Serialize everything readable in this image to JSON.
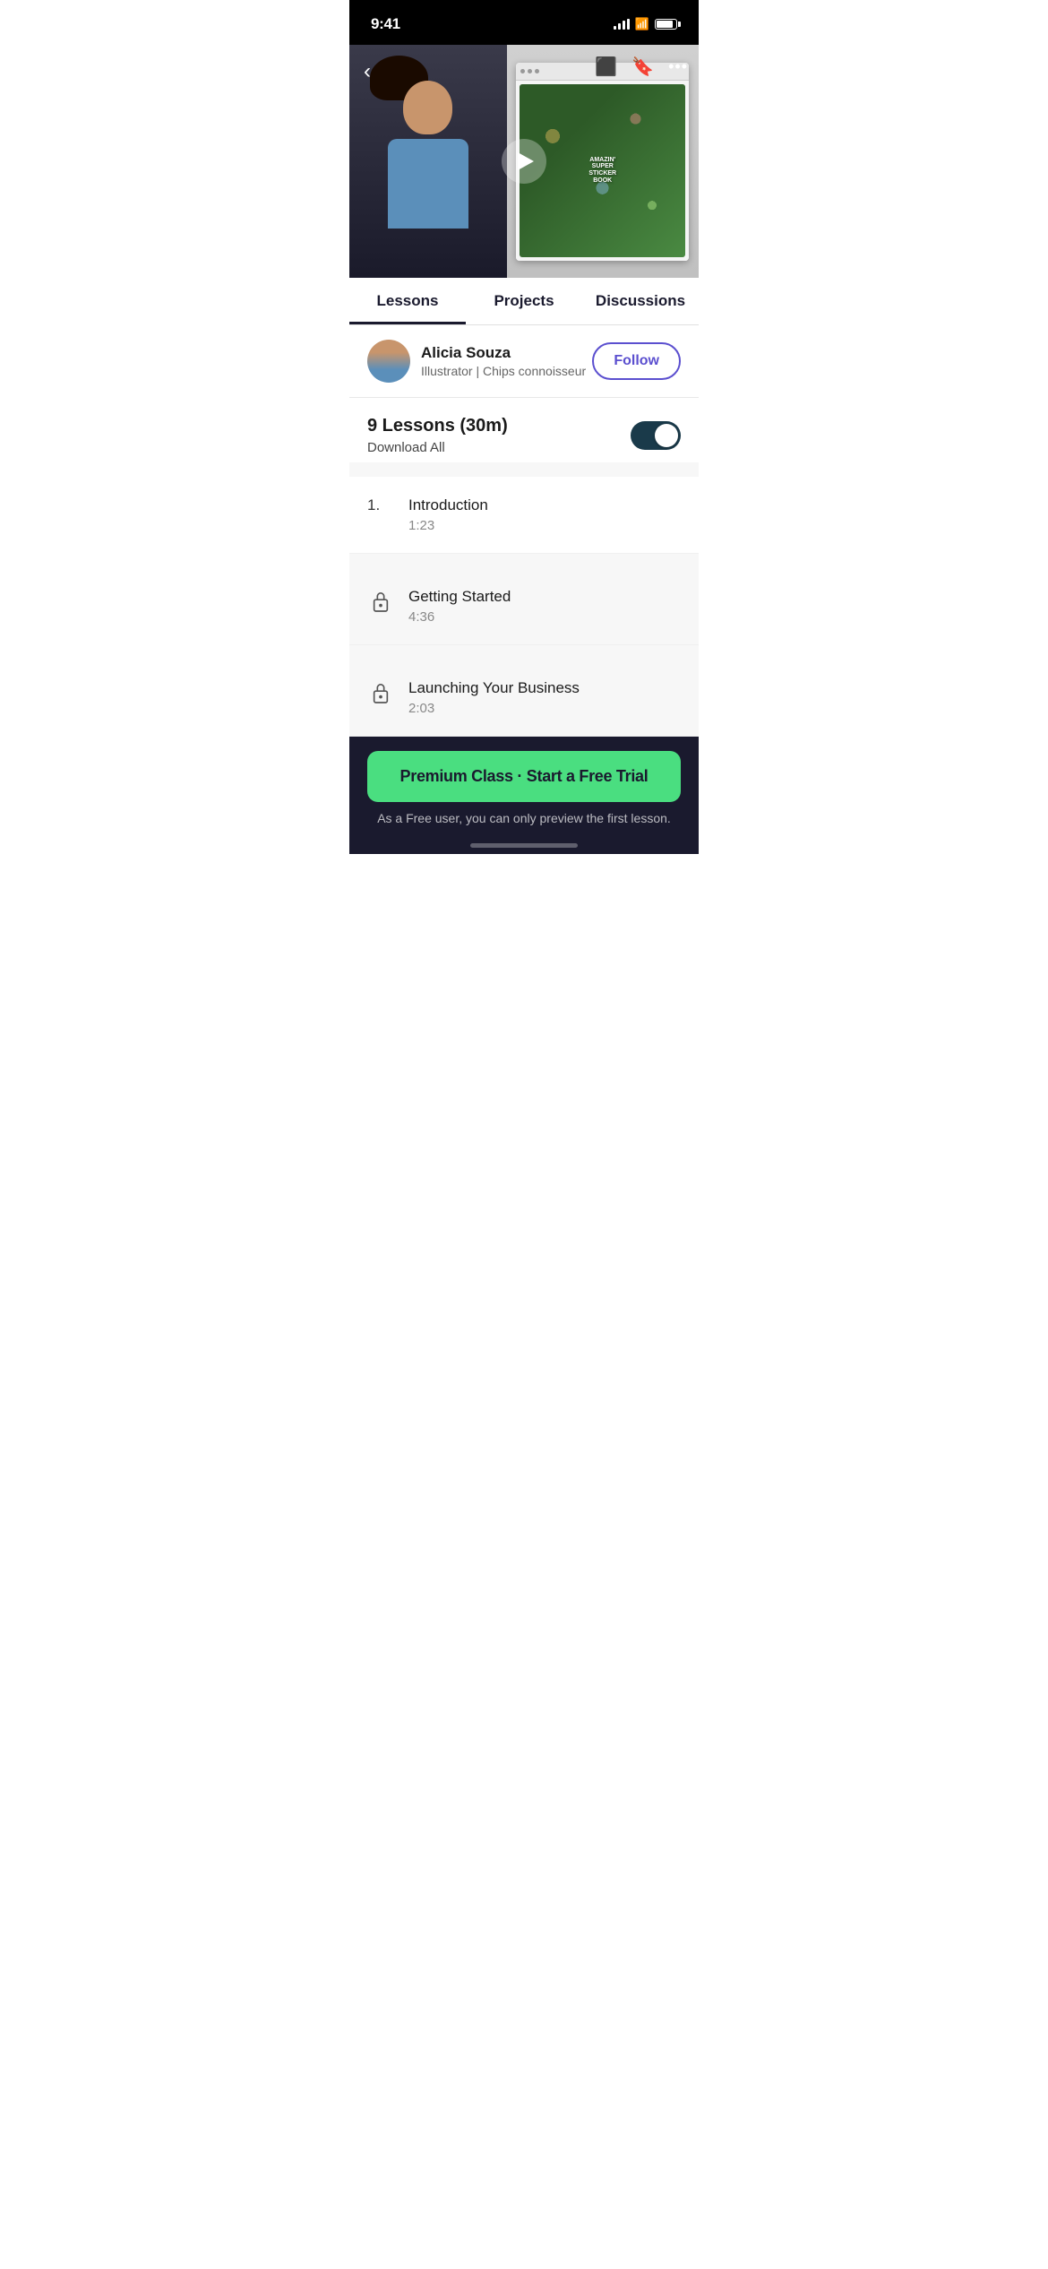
{
  "statusBar": {
    "time": "9:41"
  },
  "videoControls": {
    "backLabel": "‹",
    "moreLabel": "•••"
  },
  "tabs": [
    {
      "id": "lessons",
      "label": "Lessons",
      "active": true
    },
    {
      "id": "projects",
      "label": "Projects",
      "active": false
    },
    {
      "id": "discussions",
      "label": "Discussions",
      "active": false
    }
  ],
  "instructor": {
    "name": "Alicia Souza",
    "title": "Illustrator | Chips connoisseur",
    "followLabel": "Follow"
  },
  "lessonsSection": {
    "title": "9 Lessons (30m)",
    "downloadLabel": "Download All"
  },
  "lessons": [
    {
      "index": 1,
      "number": "1.",
      "name": "Introduction",
      "duration": "1:23",
      "locked": false
    },
    {
      "index": 2,
      "number": null,
      "name": "Getting Started",
      "duration": "4:36",
      "locked": true
    },
    {
      "index": 3,
      "number": null,
      "name": "Launching Your Business",
      "duration": "2:03",
      "locked": true
    }
  ],
  "cta": {
    "buttonLabel": "Premium Class · Start a Free Trial",
    "subtitle": "As a Free user, you can only preview the first lesson."
  },
  "colors": {
    "accent": "#4ade80",
    "followButton": "#5b4fcf",
    "darkBg": "#1a1a2e",
    "toggleBg": "#1a3a4a"
  }
}
